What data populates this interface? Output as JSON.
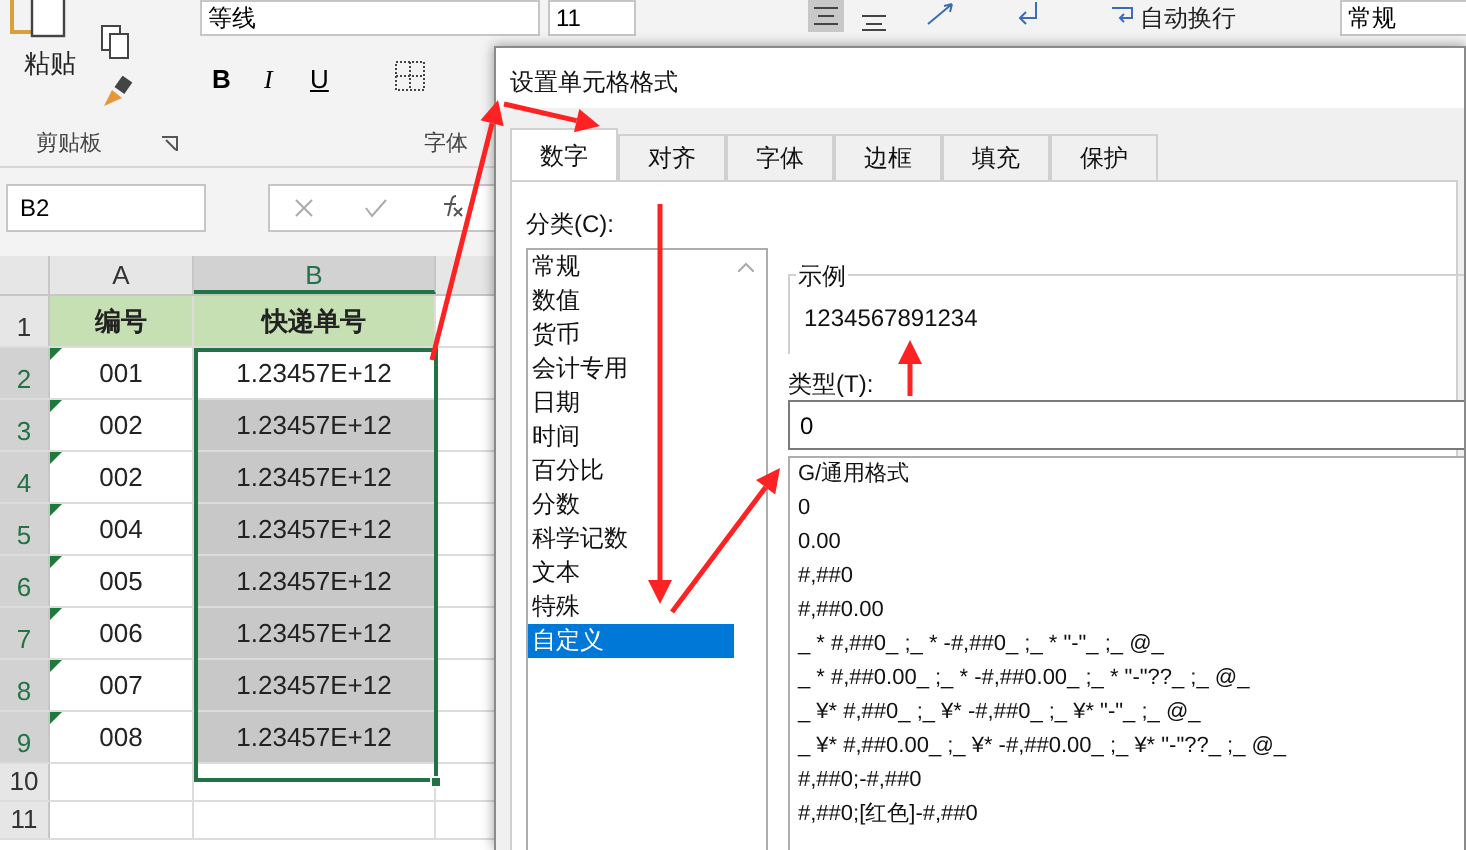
{
  "ribbon": {
    "paste_label": "粘贴",
    "font_name": "等线",
    "font_size": "11",
    "bold": "B",
    "italic": "I",
    "underline": "U",
    "wrap_text": "自动换行",
    "number_format": "常规",
    "groups": [
      "剪贴板",
      "字体"
    ]
  },
  "formula_bar": {
    "name_box": "B2"
  },
  "sheet": {
    "columns": [
      {
        "label": "A",
        "selected": false
      },
      {
        "label": "B",
        "selected": true
      }
    ],
    "rows": [
      {
        "number": "1",
        "cells": [
          "编号",
          "快递单号"
        ],
        "kind": "header",
        "selected": false
      },
      {
        "number": "2",
        "cells": [
          "001",
          "1.23457E+12"
        ],
        "kind": "data",
        "selected": true
      },
      {
        "number": "3",
        "cells": [
          "002",
          "1.23457E+12"
        ],
        "kind": "data",
        "selected": true
      },
      {
        "number": "4",
        "cells": [
          "002",
          "1.23457E+12"
        ],
        "kind": "data",
        "selected": true
      },
      {
        "number": "5",
        "cells": [
          "004",
          "1.23457E+12"
        ],
        "kind": "data",
        "selected": true
      },
      {
        "number": "6",
        "cells": [
          "005",
          "1.23457E+12"
        ],
        "kind": "data",
        "selected": true
      },
      {
        "number": "7",
        "cells": [
          "006",
          "1.23457E+12"
        ],
        "kind": "data",
        "selected": true
      },
      {
        "number": "8",
        "cells": [
          "007",
          "1.23457E+12"
        ],
        "kind": "data",
        "selected": true
      },
      {
        "number": "9",
        "cells": [
          "008",
          "1.23457E+12"
        ],
        "kind": "data",
        "selected": true
      },
      {
        "number": "10",
        "cells": [],
        "kind": "empty",
        "selected": false
      },
      {
        "number": "11",
        "cells": [],
        "kind": "empty",
        "selected": false
      }
    ]
  },
  "dialog": {
    "title": "设置单元格格式",
    "tabs": [
      {
        "label": "数字",
        "selected": true
      },
      {
        "label": "对齐",
        "selected": false
      },
      {
        "label": "字体",
        "selected": false
      },
      {
        "label": "边框",
        "selected": false
      },
      {
        "label": "填充",
        "selected": false
      },
      {
        "label": "保护",
        "selected": false
      }
    ],
    "category_label": "分类(C):",
    "categories": [
      {
        "label": "常规",
        "selected": false
      },
      {
        "label": "数值",
        "selected": false
      },
      {
        "label": "货币",
        "selected": false
      },
      {
        "label": "会计专用",
        "selected": false
      },
      {
        "label": "日期",
        "selected": false
      },
      {
        "label": "时间",
        "selected": false
      },
      {
        "label": "百分比",
        "selected": false
      },
      {
        "label": "分数",
        "selected": false
      },
      {
        "label": "科学记数",
        "selected": false
      },
      {
        "label": "文本",
        "selected": false
      },
      {
        "label": "特殊",
        "selected": false
      },
      {
        "label": "自定义",
        "selected": true
      }
    ],
    "sample_label": "示例",
    "sample_value": "1234567891234",
    "type_label": "类型(T):",
    "type_value": "0",
    "formats": [
      "G/通用格式",
      "0",
      "0.00",
      "#,##0",
      "#,##0.00",
      "_ * #,##0_ ;_ * -#,##0_ ;_ * \"-\"_ ;_ @_",
      "_ * #,##0.00_ ;_ * -#,##0.00_ ;_ * \"-\"??_ ;_ @_",
      "_ ¥* #,##0_ ;_ ¥* -#,##0_ ;_ ¥* \"-\"_ ;_ @_",
      "_ ¥* #,##0.00_ ;_ ¥* -#,##0.00_ ;_ ¥* \"-\"??_ ;_ @_",
      "#,##0;-#,##0",
      "#,##0;[红色]-#,##0"
    ]
  }
}
